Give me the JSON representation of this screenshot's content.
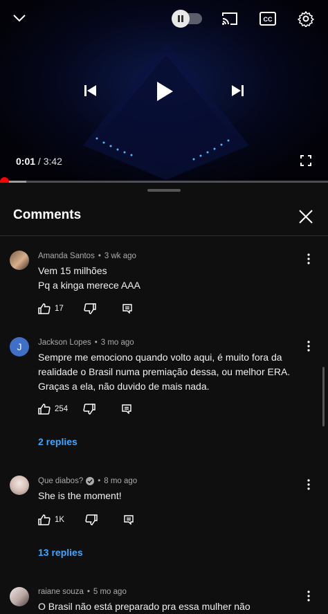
{
  "player": {
    "current_time": "0:01",
    "separator": " / ",
    "duration": "3:42",
    "progress_fraction": 0.005,
    "buffered_fraction": 0.08,
    "autoplay_state": "on",
    "accent_color": "#ff0000"
  },
  "comments_panel": {
    "title": "Comments",
    "close_icon": "close-icon"
  },
  "comments": [
    {
      "author": "Amanda Santos",
      "age": "3 wk ago",
      "lines": [
        "Vem 15 milhões",
        "Pq a kinga merece AAA"
      ],
      "likes": "17",
      "verified": false,
      "avatar_letter": "",
      "replies": ""
    },
    {
      "author": "Jackson Lopes",
      "age": "3 mo ago",
      "lines": [
        "Sempre me emociono quando volto aqui, é muito fora da",
        "realidade o Brasil numa premiação dessa, ou melhor ERA.",
        "Graças a ela, não duvido de mais nada."
      ],
      "likes": "254",
      "verified": false,
      "avatar_letter": "J",
      "avatar_color": "#3f6fc6",
      "replies": "2 replies"
    },
    {
      "author": "Que diabos?",
      "age": "8 mo ago",
      "lines": [
        "She is the moment!"
      ],
      "likes": "1K",
      "verified": true,
      "avatar_letter": "",
      "replies": "13 replies"
    },
    {
      "author": "raiane souza",
      "age": "5 mo ago",
      "lines": [
        "O Brasil não está preparado pra essa mulher não"
      ],
      "likes": "",
      "verified": false,
      "avatar_letter": "",
      "replies": ""
    }
  ],
  "misc": {
    "dot": "•"
  }
}
